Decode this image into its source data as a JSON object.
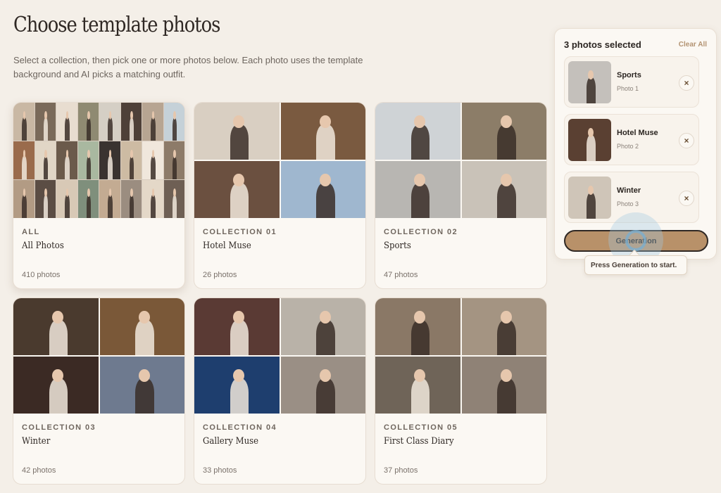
{
  "header": {
    "title": "Choose template photos",
    "subtitle": "Select a collection, then pick one or more photos below. Each photo uses the template background and AI picks a matching outfit."
  },
  "collections": [
    {
      "eyebrow": "ALL",
      "title": "All Photos",
      "count": "410 photos",
      "palette": [
        "#c9b8a4",
        "#7a6a5a",
        "#e8ddd0",
        "#8f8a72",
        "#d5cfc5",
        "#4e4038",
        "#b7a592",
        "#c5d1d8",
        "#9a6b4c",
        "#e1d6c6",
        "#6b5a4b",
        "#a9b8a0",
        "#3a3330",
        "#cdbba3",
        "#f0e7dc",
        "#8d7b69",
        "#b29b84",
        "#5b4d44",
        "#d8c9b6",
        "#7f8f7c",
        "#c3ab92",
        "#9b8d80",
        "#e4d8c8",
        "#6e5f54"
      ]
    },
    {
      "eyebrow": "COLLECTION 01",
      "title": "Hotel Muse",
      "count": "26 photos",
      "palette": [
        "#d9cfc2",
        "#7a5a40",
        "#6b5040",
        "#9fb7cf"
      ]
    },
    {
      "eyebrow": "COLLECTION 02",
      "title": "Sports",
      "count": "47 photos",
      "palette": [
        "#cfd3d6",
        "#8c7d68",
        "#b8b6b2",
        "#c9c2b8"
      ]
    },
    {
      "eyebrow": "COLLECTION 03",
      "title": "Winter",
      "count": "42 photos",
      "palette": [
        "#4a3a2e",
        "#7a5838",
        "#3b2a24",
        "#6e7a8f"
      ]
    },
    {
      "eyebrow": "COLLECTION 04",
      "title": "Gallery Muse",
      "count": "33 photos",
      "palette": [
        "#5a3a34",
        "#b9b2a8",
        "#1e3e6e",
        "#9a8f85"
      ]
    },
    {
      "eyebrow": "COLLECTION 05",
      "title": "First Class Diary",
      "count": "37 photos",
      "palette": [
        "#8a7866",
        "#a49482",
        "#6f6458",
        "#8f8276"
      ]
    }
  ],
  "selection": {
    "title": "3 photos selected",
    "clear_label": "Clear All",
    "items": [
      {
        "name": "Sports",
        "sub": "Photo 1",
        "color": "#c4c0bb",
        "remove": "×"
      },
      {
        "name": "Hotel Muse",
        "sub": "Photo 2",
        "color": "#5a4032",
        "remove": "×"
      },
      {
        "name": "Winter",
        "sub": "Photo 3",
        "color": "#cfc5b8",
        "remove": "×"
      }
    ],
    "generate_label": "Generation",
    "tooltip": "Press Generation to start."
  },
  "colors": {
    "background": "#f4efe8",
    "accent": "#b89169"
  }
}
